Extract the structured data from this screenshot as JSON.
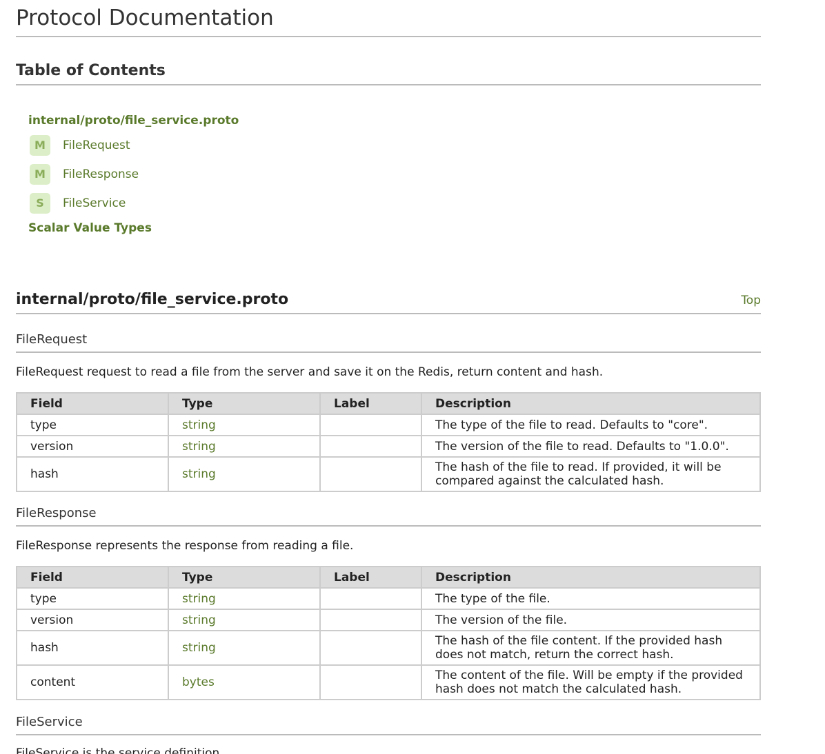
{
  "doc": {
    "title": "Protocol Documentation",
    "toc_title": "Table of Contents"
  },
  "toc": {
    "file": "internal/proto/file_service.proto",
    "items": [
      {
        "badge": "M",
        "label": "FileRequest"
      },
      {
        "badge": "M",
        "label": "FileResponse"
      },
      {
        "badge": "S",
        "label": "FileService"
      }
    ],
    "scalar": "Scalar Value Types"
  },
  "file_section": {
    "title": "internal/proto/file_service.proto",
    "top_link": "Top"
  },
  "table_headers": {
    "field": "Field",
    "type": "Type",
    "label": "Label",
    "description": "Description"
  },
  "file_request": {
    "title": "FileRequest",
    "description": "FileRequest request to read a file from the server and save it on the Redis, return content and hash.",
    "rows": [
      {
        "field": "type",
        "type": "string",
        "label": "",
        "description": "The type of the file to read. Defaults to \"core\"."
      },
      {
        "field": "version",
        "type": "string",
        "label": "",
        "description": "The version of the file to read. Defaults to \"1.0.0\"."
      },
      {
        "field": "hash",
        "type": "string",
        "label": "",
        "description": "The hash of the file to read. If provided, it will be compared against the calculated hash."
      }
    ]
  },
  "file_response": {
    "title": "FileResponse",
    "description": "FileResponse represents the response from reading a file.",
    "rows": [
      {
        "field": "type",
        "type": "string",
        "label": "",
        "description": "The type of the file."
      },
      {
        "field": "version",
        "type": "string",
        "label": "",
        "description": "The version of the file."
      },
      {
        "field": "hash",
        "type": "string",
        "label": "",
        "description": "The hash of the file content. If the provided hash does not match, return the correct hash."
      },
      {
        "field": "content",
        "type": "bytes",
        "label": "",
        "description": "The content of the file. Will be empty if the provided hash does not match the calculated hash."
      }
    ]
  },
  "file_service": {
    "title": "FileService",
    "description": "FileService is the service definition."
  },
  "colors": {
    "link": "#5a7a2b",
    "badge_bg": "#dceec8",
    "badge_text": "#8aad5a",
    "header_bg": "#dcdcdc",
    "border": "#cccccc"
  }
}
